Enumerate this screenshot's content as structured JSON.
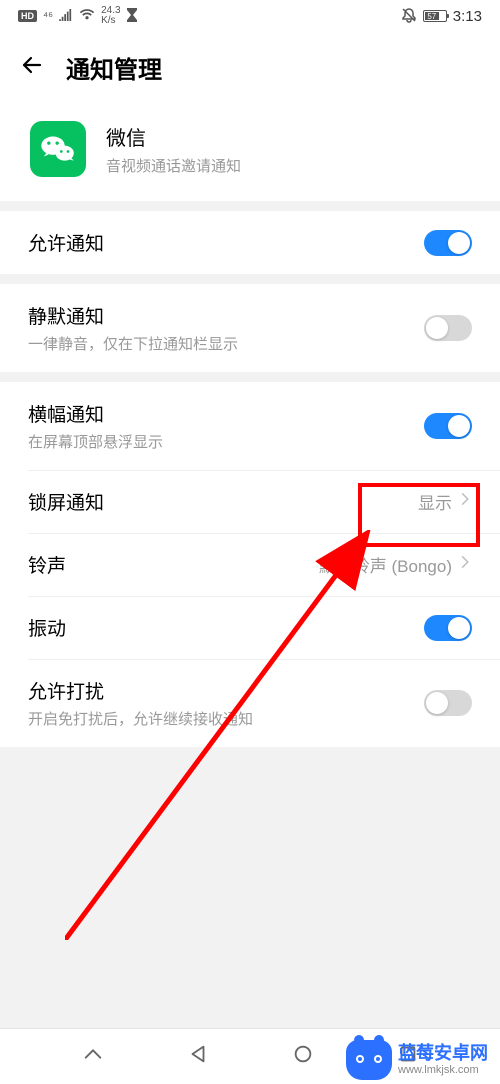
{
  "status": {
    "hd": "HD",
    "net_gen": "⁴⁶",
    "speed_top": "24.3",
    "speed_bottom": "K/s",
    "battery_pct": "57",
    "time": "3:13"
  },
  "header": {
    "title": "通知管理"
  },
  "app": {
    "name": "微信",
    "subtitle": "音视频通话邀请通知"
  },
  "rows": {
    "allow": {
      "title": "允许通知",
      "on": true
    },
    "silent": {
      "title": "静默通知",
      "sub": "一律静音，仅在下拉通知栏显示",
      "on": false
    },
    "banner": {
      "title": "横幅通知",
      "sub": "在屏幕顶部悬浮显示",
      "on": true
    },
    "lockscreen": {
      "title": "锁屏通知",
      "value": "显示"
    },
    "ringtone": {
      "title": "铃声",
      "value": "默认铃声 (Bongo)"
    },
    "vibrate": {
      "title": "振动",
      "on": true
    },
    "disturb": {
      "title": "允许打扰",
      "sub": "开启免打扰后，允许继续接收通知",
      "on": false
    }
  },
  "watermark": {
    "line1": "蓝莓安卓网",
    "line2": "www.lmkjsk.com"
  }
}
